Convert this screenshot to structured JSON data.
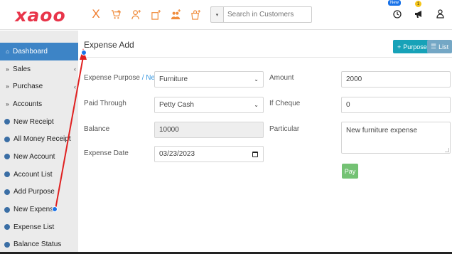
{
  "brand": {
    "logo_text": "xaoo",
    "logo_color": "#e8354a"
  },
  "toolbar": {
    "icons": [
      "close-icon",
      "cart-add-icon",
      "user-add-icon",
      "box-add-icon",
      "team-add-icon",
      "bag-add-icon",
      "coin-add-icon"
    ],
    "close_glyph": "X",
    "search": {
      "placeholder": "Search in Customers",
      "dropdown_glyph": "▾"
    }
  },
  "top_right": {
    "badge_new": "New",
    "badge_count": "1",
    "icons": [
      "clock-icon",
      "megaphone-icon",
      "user-icon"
    ]
  },
  "sidebar": {
    "items": [
      {
        "label": "Dashboard",
        "icon": "home-icon",
        "glyph": "⌂",
        "active": true
      },
      {
        "label": "Sales",
        "icon": "double-chevron-icon",
        "glyph": "»",
        "chevron": "‹"
      },
      {
        "label": "Purchase",
        "icon": "double-chevron-icon",
        "glyph": "»",
        "chevron": "‹"
      },
      {
        "label": "Accounts",
        "icon": "double-chevron-icon",
        "glyph": "»"
      },
      {
        "label": "New Receipt",
        "icon": "circle-arrow-icon"
      },
      {
        "label": "All Money Receipt",
        "icon": "circle-arrow-icon"
      },
      {
        "label": "New Account",
        "icon": "circle-arrow-icon"
      },
      {
        "label": "Account List",
        "icon": "circle-arrow-icon"
      },
      {
        "label": "Add Purpose",
        "icon": "circle-arrow-icon"
      },
      {
        "label": "New Expense",
        "icon": "circle-arrow-icon"
      },
      {
        "label": "Expense List",
        "icon": "circle-arrow-icon"
      },
      {
        "label": "Balance Status",
        "icon": "circle-arrow-icon"
      }
    ]
  },
  "main": {
    "title": "Expense Add",
    "purpose_button": "Purpose",
    "purpose_glyph": "+",
    "list_button": "List",
    "list_glyph": "☰",
    "form": {
      "expense_purpose_label": "Expense Purpose",
      "expense_purpose_sep": " / ",
      "expense_purpose_new": "New",
      "expense_purpose_value": "Furniture",
      "paid_through_label": "Paid Through",
      "paid_through_value": "Petty Cash",
      "balance_label": "Balance",
      "balance_value": "10000",
      "expense_date_label": "Expense Date",
      "expense_date_value": "03/23/2023",
      "amount_label": "Amount",
      "amount_value": "2000",
      "if_cheque_label": "If Cheque",
      "if_cheque_value": "0",
      "particular_label": "Particular",
      "particular_value": "New furniture expense",
      "pay_button": "Pay"
    }
  },
  "colors": {
    "accent_blue": "#3d84c6",
    "teal": "#17a2b8",
    "pay_green": "#5cb85c",
    "annotation_red": "#e02020"
  }
}
